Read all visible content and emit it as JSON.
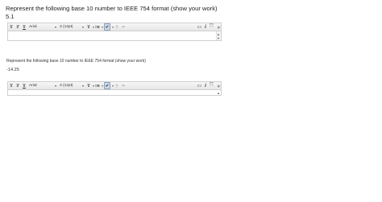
{
  "question1": {
    "prompt": "Represent the following base 10 number to IEEE 754 format (show your work)",
    "value": "5.1"
  },
  "question2": {
    "prompt": "Represent the following base 10 number to IEEE 754 format (show your work)",
    "value": "-14.25"
  },
  "toolbar": {
    "font_family": "Arial",
    "font_size": "3 (12pt)",
    "bold_glyph": "T",
    "italic_glyph": "T",
    "strike_glyph": "T",
    "text_color_glyph": "T",
    "list_glyph": "⁝≡",
    "check_glyph": "✔",
    "link_glyph": "⚲",
    "unlink_glyph": "⚮",
    "spell_glyph": "▭",
    "info_glyph": "i",
    "expand_glyph": "⤧",
    "collapse_glyph": "»",
    "dropdown_glyph": "▾"
  }
}
